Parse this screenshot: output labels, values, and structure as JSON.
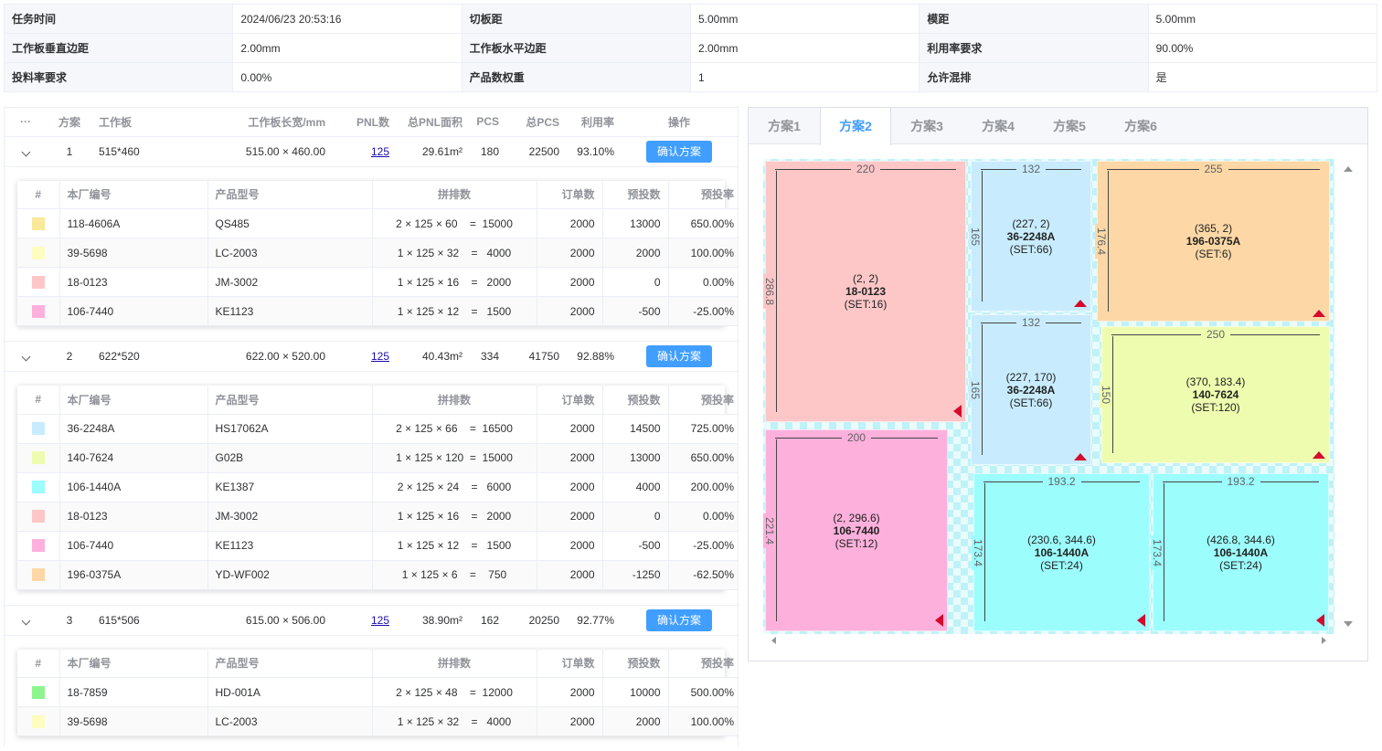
{
  "info": [
    [
      {
        "k": "任务时间",
        "v": "2024/06/23 20:53:16"
      },
      {
        "k": "切板距",
        "v": "5.00mm"
      },
      {
        "k": "模距",
        "v": "5.00mm"
      }
    ],
    [
      {
        "k": "工作板垂直边距",
        "v": "2.00mm"
      },
      {
        "k": "工作板水平边距",
        "v": "2.00mm"
      },
      {
        "k": "利用率要求",
        "v": "90.00%"
      }
    ],
    [
      {
        "k": "投料率要求",
        "v": "0.00%"
      },
      {
        "k": "产品数权重",
        "v": "1"
      },
      {
        "k": "允许混排",
        "v": "是"
      }
    ]
  ],
  "main_headers": {
    "more": "···",
    "plan": "方案",
    "board": "工作板",
    "size": "工作板长宽/mm",
    "pnl": "PNL数",
    "area": "总PNL面积",
    "pcs": "PCS",
    "total": "总PCS",
    "util": "利用率",
    "op": "操作"
  },
  "inner_headers": {
    "idx": "#",
    "code": "本厂编号",
    "model": "产品型号",
    "layout": "拼排数",
    "order": "订单数",
    "pre": "预投数",
    "rate": "预投率"
  },
  "plans": [
    {
      "no": "1",
      "board": "515*460",
      "size": "515.00 × 460.00",
      "pnl": "125",
      "area": "29.61m²",
      "pcs": "180",
      "total": "22500",
      "util": "93.10%",
      "btn": "确认方案",
      "items": [
        {
          "color": "#fae89b",
          "code": "118-4606A",
          "model": "QS485",
          "layout": "2 × 125 × 60    =  15000",
          "order": "2000",
          "pre": "13000",
          "rate": "650.00%"
        },
        {
          "color": "#fdfcc1",
          "code": "39-5698",
          "model": "LC-2003",
          "layout": "1 × 125 × 32    =   4000",
          "order": "2000",
          "pre": "2000",
          "rate": "100.00%"
        },
        {
          "color": "#fdc7c7",
          "code": "18-0123",
          "model": "JM-3002",
          "layout": "1 × 125 × 16    =   2000",
          "order": "2000",
          "pre": "0",
          "rate": "0.00%"
        },
        {
          "color": "#fdb0db",
          "code": "106-7440",
          "model": "KE1123",
          "layout": "1 × 125 × 12    =   1500",
          "order": "2000",
          "pre": "-500",
          "rate": "-25.00%"
        }
      ]
    },
    {
      "no": "2",
      "board": "622*520",
      "size": "622.00 × 520.00",
      "pnl": "125",
      "area": "40.43m²",
      "pcs": "334",
      "total": "41750",
      "util": "92.88%",
      "btn": "确认方案",
      "items": [
        {
          "color": "#c8ecfd",
          "code": "36-2248A",
          "model": "HS17062A",
          "layout": "2 × 125 × 66    =  16500",
          "order": "2000",
          "pre": "14500",
          "rate": "725.00%"
        },
        {
          "color": "#eefcb0",
          "code": "140-7624",
          "model": "G02B",
          "layout": "1 × 125 × 120  =  15000",
          "order": "2000",
          "pre": "13000",
          "rate": "650.00%"
        },
        {
          "color": "#9cfdfd",
          "code": "106-1440A",
          "model": "KE1387",
          "layout": "2 × 125 × 24    =   6000",
          "order": "2000",
          "pre": "4000",
          "rate": "200.00%"
        },
        {
          "color": "#fdc7c7",
          "code": "18-0123",
          "model": "JM-3002",
          "layout": "1 × 125 × 16    =   2000",
          "order": "2000",
          "pre": "0",
          "rate": "0.00%"
        },
        {
          "color": "#fdb0db",
          "code": "106-7440",
          "model": "KE1123",
          "layout": "1 × 125 × 12    =   1500",
          "order": "2000",
          "pre": "-500",
          "rate": "-25.00%"
        },
        {
          "color": "#fdd8a6",
          "code": "196-0375A",
          "model": "YD-WF002",
          "layout": "1 × 125 × 6    =    750",
          "order": "2000",
          "pre": "-1250",
          "rate": "-62.50%"
        }
      ]
    },
    {
      "no": "3",
      "board": "615*506",
      "size": "615.00 × 506.00",
      "pnl": "125",
      "area": "38.90m²",
      "pcs": "162",
      "total": "20250",
      "util": "92.77%",
      "btn": "确认方案",
      "items": [
        {
          "color": "#8ef58e",
          "code": "18-7859",
          "model": "HD-001A",
          "layout": "2 × 125 × 48    =  12000",
          "order": "2000",
          "pre": "10000",
          "rate": "500.00%"
        },
        {
          "color": "#fdfcc1",
          "code": "39-5698",
          "model": "LC-2003",
          "layout": "1 × 125 × 32    =   4000",
          "order": "2000",
          "pre": "2000",
          "rate": "100.00%"
        }
      ]
    }
  ],
  "tabs": [
    "方案1",
    "方案2",
    "方案3",
    "方案4",
    "方案5",
    "方案6"
  ],
  "active_tab": 1,
  "pieces": [
    {
      "w": "220",
      "h": "286.8",
      "pos": "(2, 2)",
      "pn": "18-0123",
      "set": "(SET:16)",
      "color": "#fdc7c7",
      "mark": "left"
    },
    {
      "w": "132",
      "h": "165",
      "pos": "(227, 2)",
      "pn": "36-2248A",
      "set": "(SET:66)",
      "color": "#c8ecfd",
      "mark": "up"
    },
    {
      "w": "255",
      "h": "176.4",
      "pos": "(365, 2)",
      "pn": "196-0375A",
      "set": "(SET:6)",
      "color": "#fdd8a6",
      "mark": "up"
    },
    {
      "w": "132",
      "h": "165",
      "pos": "(227, 170)",
      "pn": "36-2248A",
      "set": "(SET:66)",
      "color": "#c8ecfd",
      "mark": "up"
    },
    {
      "w": "250",
      "h": "150",
      "pos": "(370, 183.4)",
      "pn": "140-7624",
      "set": "(SET:120)",
      "color": "#eefcb0",
      "mark": "up"
    },
    {
      "w": "200",
      "h": "221.4",
      "pos": "(2, 296.6)",
      "pn": "106-7440",
      "set": "(SET:12)",
      "color": "#fdb0db",
      "mark": "left"
    },
    {
      "w": "193.2",
      "h": "173.4",
      "pos": "(230.6, 344.6)",
      "pn": "106-1440A",
      "set": "(SET:24)",
      "color": "#9cfdfd",
      "mark": "left"
    },
    {
      "w": "193.2",
      "h": "173.4",
      "pos": "(426.8, 344.6)",
      "pn": "106-1440A",
      "set": "(SET:24)",
      "color": "#9cfdfd",
      "mark": "left"
    }
  ]
}
